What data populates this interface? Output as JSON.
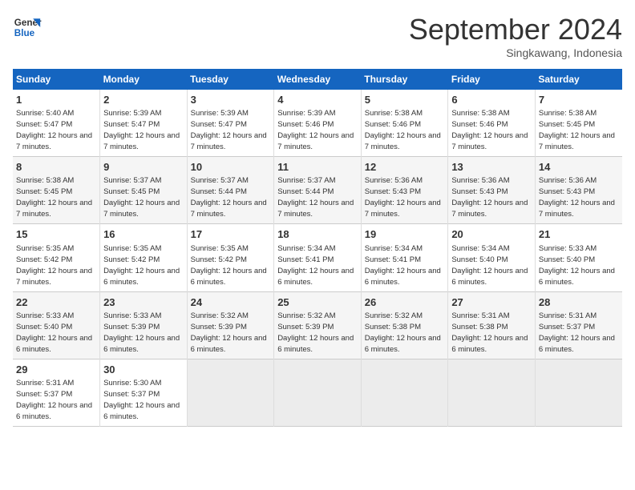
{
  "header": {
    "logo_general": "General",
    "logo_blue": "Blue",
    "title": "September 2024",
    "location": "Singkawang, Indonesia"
  },
  "columns": [
    "Sunday",
    "Monday",
    "Tuesday",
    "Wednesday",
    "Thursday",
    "Friday",
    "Saturday"
  ],
  "weeks": [
    [
      {
        "day": "1",
        "sunrise": "5:40 AM",
        "sunset": "5:47 PM",
        "daylight": "12 hours and 7 minutes."
      },
      {
        "day": "2",
        "sunrise": "5:39 AM",
        "sunset": "5:47 PM",
        "daylight": "12 hours and 7 minutes."
      },
      {
        "day": "3",
        "sunrise": "5:39 AM",
        "sunset": "5:47 PM",
        "daylight": "12 hours and 7 minutes."
      },
      {
        "day": "4",
        "sunrise": "5:39 AM",
        "sunset": "5:46 PM",
        "daylight": "12 hours and 7 minutes."
      },
      {
        "day": "5",
        "sunrise": "5:38 AM",
        "sunset": "5:46 PM",
        "daylight": "12 hours and 7 minutes."
      },
      {
        "day": "6",
        "sunrise": "5:38 AM",
        "sunset": "5:46 PM",
        "daylight": "12 hours and 7 minutes."
      },
      {
        "day": "7",
        "sunrise": "5:38 AM",
        "sunset": "5:45 PM",
        "daylight": "12 hours and 7 minutes."
      }
    ],
    [
      {
        "day": "8",
        "sunrise": "5:38 AM",
        "sunset": "5:45 PM",
        "daylight": "12 hours and 7 minutes."
      },
      {
        "day": "9",
        "sunrise": "5:37 AM",
        "sunset": "5:45 PM",
        "daylight": "12 hours and 7 minutes."
      },
      {
        "day": "10",
        "sunrise": "5:37 AM",
        "sunset": "5:44 PM",
        "daylight": "12 hours and 7 minutes."
      },
      {
        "day": "11",
        "sunrise": "5:37 AM",
        "sunset": "5:44 PM",
        "daylight": "12 hours and 7 minutes."
      },
      {
        "day": "12",
        "sunrise": "5:36 AM",
        "sunset": "5:43 PM",
        "daylight": "12 hours and 7 minutes."
      },
      {
        "day": "13",
        "sunrise": "5:36 AM",
        "sunset": "5:43 PM",
        "daylight": "12 hours and 7 minutes."
      },
      {
        "day": "14",
        "sunrise": "5:36 AM",
        "sunset": "5:43 PM",
        "daylight": "12 hours and 7 minutes."
      }
    ],
    [
      {
        "day": "15",
        "sunrise": "5:35 AM",
        "sunset": "5:42 PM",
        "daylight": "12 hours and 7 minutes."
      },
      {
        "day": "16",
        "sunrise": "5:35 AM",
        "sunset": "5:42 PM",
        "daylight": "12 hours and 6 minutes."
      },
      {
        "day": "17",
        "sunrise": "5:35 AM",
        "sunset": "5:42 PM",
        "daylight": "12 hours and 6 minutes."
      },
      {
        "day": "18",
        "sunrise": "5:34 AM",
        "sunset": "5:41 PM",
        "daylight": "12 hours and 6 minutes."
      },
      {
        "day": "19",
        "sunrise": "5:34 AM",
        "sunset": "5:41 PM",
        "daylight": "12 hours and 6 minutes."
      },
      {
        "day": "20",
        "sunrise": "5:34 AM",
        "sunset": "5:40 PM",
        "daylight": "12 hours and 6 minutes."
      },
      {
        "day": "21",
        "sunrise": "5:33 AM",
        "sunset": "5:40 PM",
        "daylight": "12 hours and 6 minutes."
      }
    ],
    [
      {
        "day": "22",
        "sunrise": "5:33 AM",
        "sunset": "5:40 PM",
        "daylight": "12 hours and 6 minutes."
      },
      {
        "day": "23",
        "sunrise": "5:33 AM",
        "sunset": "5:39 PM",
        "daylight": "12 hours and 6 minutes."
      },
      {
        "day": "24",
        "sunrise": "5:32 AM",
        "sunset": "5:39 PM",
        "daylight": "12 hours and 6 minutes."
      },
      {
        "day": "25",
        "sunrise": "5:32 AM",
        "sunset": "5:39 PM",
        "daylight": "12 hours and 6 minutes."
      },
      {
        "day": "26",
        "sunrise": "5:32 AM",
        "sunset": "5:38 PM",
        "daylight": "12 hours and 6 minutes."
      },
      {
        "day": "27",
        "sunrise": "5:31 AM",
        "sunset": "5:38 PM",
        "daylight": "12 hours and 6 minutes."
      },
      {
        "day": "28",
        "sunrise": "5:31 AM",
        "sunset": "5:37 PM",
        "daylight": "12 hours and 6 minutes."
      }
    ],
    [
      {
        "day": "29",
        "sunrise": "5:31 AM",
        "sunset": "5:37 PM",
        "daylight": "12 hours and 6 minutes."
      },
      {
        "day": "30",
        "sunrise": "5:30 AM",
        "sunset": "5:37 PM",
        "daylight": "12 hours and 6 minutes."
      },
      null,
      null,
      null,
      null,
      null
    ]
  ]
}
